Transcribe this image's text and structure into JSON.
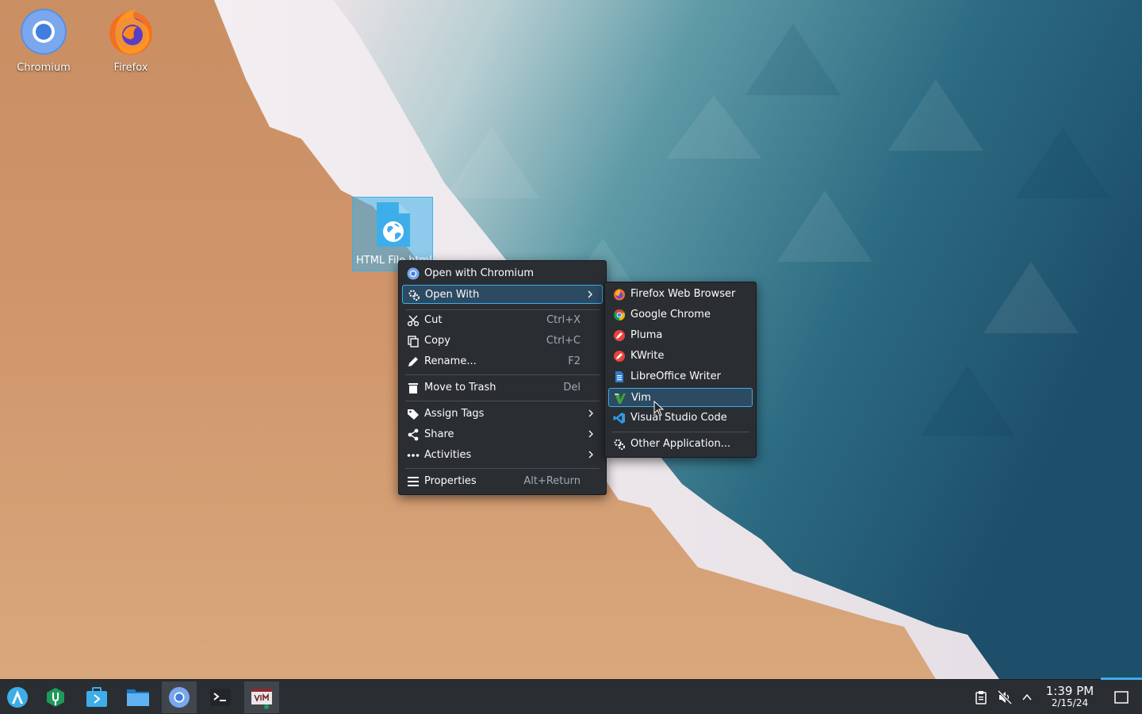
{
  "desktop_icons": [
    {
      "label": "Chromium",
      "icon": "chromium-icon"
    },
    {
      "label": "Firefox",
      "icon": "firefox-icon"
    }
  ],
  "selected_file": {
    "label": "HTML File.html",
    "icon": "html-file-icon"
  },
  "context_menu": {
    "items": [
      {
        "label": "Open with Chromium",
        "icon": "chromium-icon"
      },
      {
        "label": "Open With",
        "icon": "gear-icon",
        "submenu": true,
        "highlighted": true
      },
      {
        "label": "Cut",
        "shortcut": "Ctrl+X",
        "icon": "scissors-icon"
      },
      {
        "label": "Copy",
        "shortcut": "Ctrl+C",
        "icon": "copy-icon"
      },
      {
        "label": "Rename...",
        "shortcut": "F2",
        "icon": "pencil-icon"
      },
      {
        "label": "Move to Trash",
        "shortcut": "Del",
        "icon": "trash-icon"
      },
      {
        "label": "Assign Tags",
        "icon": "tag-icon",
        "submenu": true
      },
      {
        "label": "Share",
        "icon": "share-icon",
        "submenu": true
      },
      {
        "label": "Activities",
        "icon": "dots-icon",
        "submenu": true
      },
      {
        "label": "Properties",
        "shortcut": "Alt+Return",
        "icon": "list-icon"
      }
    ]
  },
  "open_with_menu": {
    "items": [
      {
        "label": "Firefox Web Browser",
        "icon": "firefox-icon"
      },
      {
        "label": "Google Chrome",
        "icon": "chrome-icon"
      },
      {
        "label": "Pluma",
        "icon": "pluma-icon"
      },
      {
        "label": "KWrite",
        "icon": "kwrite-icon"
      },
      {
        "label": "LibreOffice Writer",
        "icon": "libreoffice-writer-icon"
      },
      {
        "label": "Vim",
        "icon": "vim-icon",
        "highlighted": true
      },
      {
        "label": "Visual Studio Code",
        "icon": "vscode-icon"
      },
      {
        "label": "Other Application...",
        "icon": "gear-icon"
      }
    ]
  },
  "taskbar": {
    "launchers": [
      "application-launcher-icon",
      "discover-icon",
      "store-icon",
      "file-manager-icon",
      "chromium-icon",
      "terminal-icon",
      "vim-window-icon"
    ],
    "tray": [
      "clipboard-icon",
      "volume-muted-icon",
      "chevron-up-icon"
    ],
    "clock": {
      "time": "1:39 PM",
      "date": "2/15/24"
    },
    "show_desktop": "show-desktop-icon"
  },
  "colors": {
    "accent": "#3daee9",
    "menu_bg": "#2a2e32",
    "taskbar_bg": "#2a2e32"
  }
}
